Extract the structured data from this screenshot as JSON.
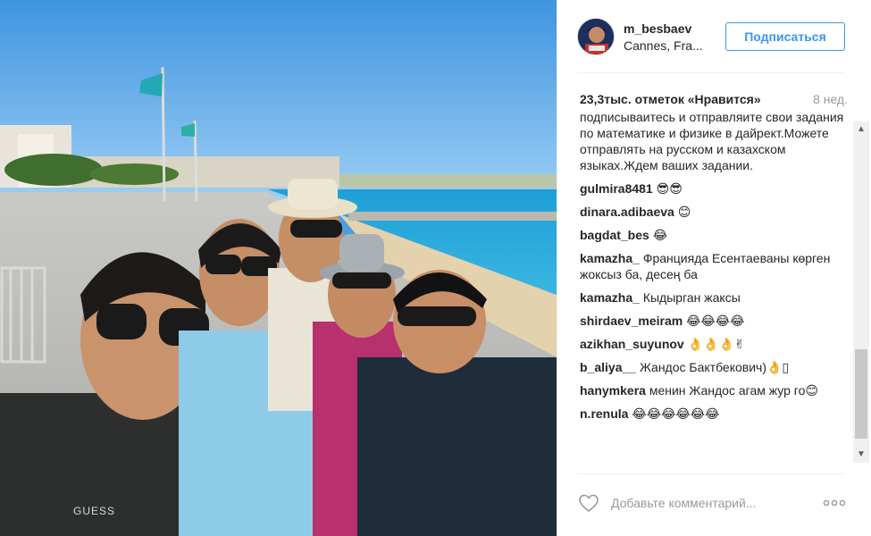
{
  "post": {
    "username": "m_besbaev",
    "location": "Cannes, Fra...",
    "follow_label": "Подписаться",
    "likes": "23,3тыс. отметок «Нравится»",
    "time_ago": "8 нед.",
    "caption": "подписывайтесь и отправляйте свои задания по математике и физике в дайрект.Можете отправлять на русском и казахском языках.Ждем ваших задании.",
    "comments": [
      {
        "author": "gulmira8481",
        "text": "😎😎"
      },
      {
        "author": "dinara.adibaeva",
        "text": "😊"
      },
      {
        "author": "bagdat_bes",
        "text": "😂"
      },
      {
        "author": "kamazha_",
        "text": "Францияда Есентаеваны көрген жоксыз ба, десең ба"
      },
      {
        "author": "kamazha_",
        "text": "Кыдырган жаксы"
      },
      {
        "author": "shirdaev_meiram",
        "text": "😂😂😂😂"
      },
      {
        "author": "azikhan_suyunov",
        "text": "👌👌👌✌"
      },
      {
        "author": "b_aliya__",
        "text": "Жандос Бактбекович)👌▯"
      },
      {
        "author": "hanymkera",
        "text": "менин Жандос агам жур го😊"
      },
      {
        "author": "n.renula",
        "text": "😂😂😂😂😂😂"
      }
    ],
    "add_comment_placeholder": "Добавьте комментарий...",
    "photo_text": {
      "shirt_brand": "GUESS"
    }
  },
  "icons": {
    "heart": "heart-icon",
    "more": "more-dots-icon",
    "scroll_up": "▲",
    "scroll_down": "▼"
  },
  "colors": {
    "accent": "#3897f0",
    "text": "#262626",
    "muted": "#999999",
    "sky": "#4b9fe0",
    "sea": "#2aa3d6"
  }
}
